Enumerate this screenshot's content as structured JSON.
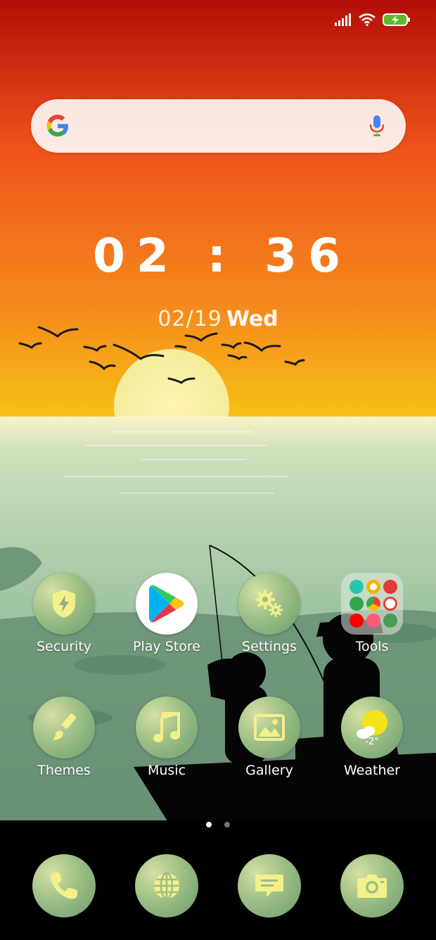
{
  "status_bar": {
    "signal_icon": "signal-bars-icon",
    "wifi_icon": "wifi-icon",
    "battery_icon": "battery-charging-icon"
  },
  "search": {
    "logo_icon": "google-g-icon",
    "voice_icon": "microphone-icon"
  },
  "clock": {
    "time": "02 : 36",
    "date": "02/19",
    "weekday": "Wed"
  },
  "apps": [
    {
      "label": "Security",
      "icon": "shield-bolt-icon"
    },
    {
      "label": "Play Store",
      "icon": "play-store-icon"
    },
    {
      "label": "Settings",
      "icon": "gears-icon"
    },
    {
      "label": "Tools",
      "icon": "folder-icon"
    },
    {
      "label": "Themes",
      "icon": "paintbrush-icon"
    },
    {
      "label": "Music",
      "icon": "music-note-icon"
    },
    {
      "label": "Gallery",
      "icon": "image-icon"
    },
    {
      "label": "Weather",
      "icon": "sun-cloud-icon",
      "temp": "-2°"
    }
  ],
  "dock": [
    {
      "icon": "phone-icon"
    },
    {
      "icon": "globe-icon"
    },
    {
      "icon": "message-icon"
    },
    {
      "icon": "camera-icon"
    }
  ],
  "pager": {
    "pages": 2,
    "current": 1
  },
  "colors": {
    "sky_top": "#b30e08",
    "sky_mid": "#f26a1b",
    "sky_low": "#f9b217",
    "sun": "#f8f1a0",
    "sea": "#7aa88b",
    "icon_green": "#9cbf85",
    "icon_yellow": "#f3f08a"
  }
}
